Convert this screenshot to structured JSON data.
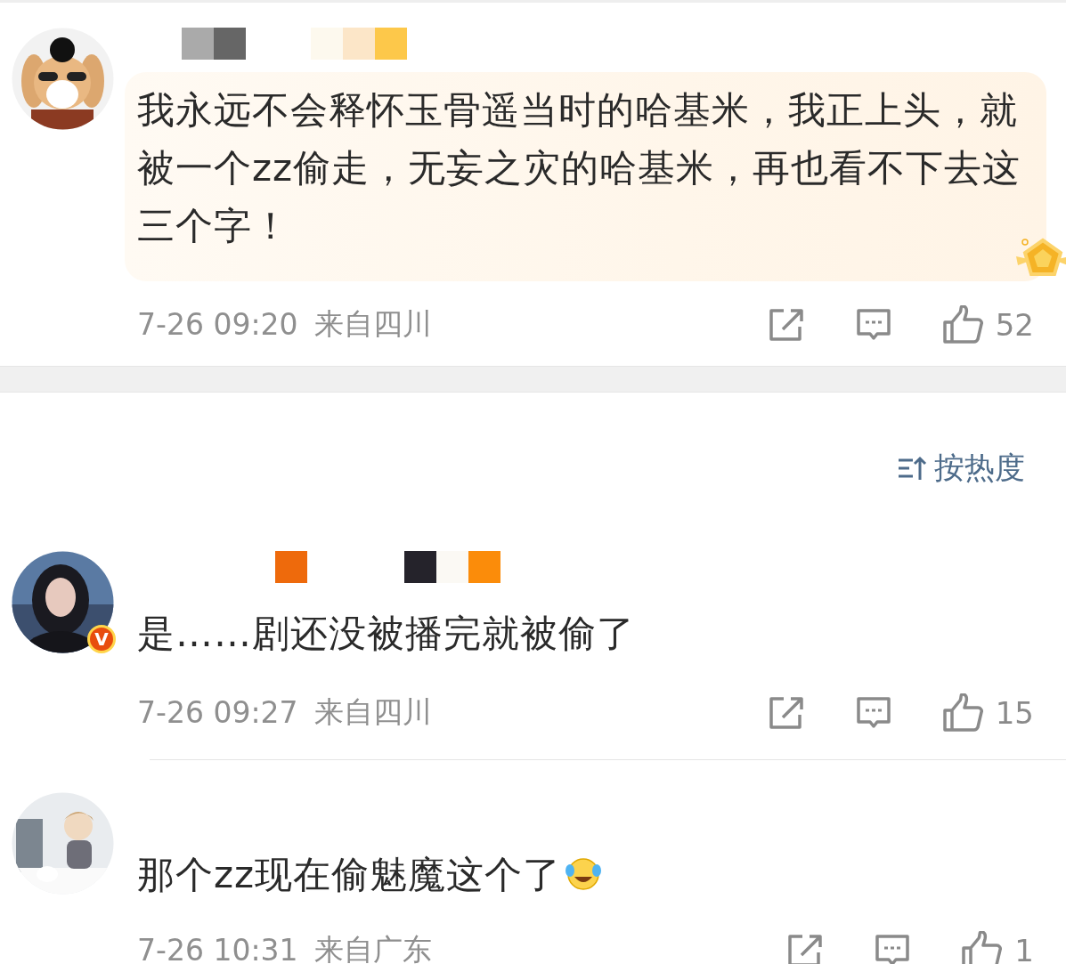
{
  "comments": [
    {
      "highlighted": true,
      "verified": false,
      "text": "我永远不会释怀玉骨遥当时的哈基米，我正上头，就被一个zz偷走，无妄之灾的哈基米，再也看不下去这三个字！",
      "emoji": false,
      "time": "7-26 09:20",
      "location": "来自四川",
      "likes": "52"
    },
    {
      "highlighted": false,
      "verified": true,
      "badge": "V",
      "text": "是……剧还没被播完就被偷了",
      "emoji": false,
      "time": "7-26 09:27",
      "location": "来自四川",
      "likes": "15"
    },
    {
      "highlighted": false,
      "verified": false,
      "text": "那个zz现在偷魅魔这个了",
      "emoji": true,
      "time": "7-26 10:31",
      "location": "来自广东",
      "likes": "1"
    }
  ],
  "sort": {
    "label": "按热度"
  }
}
